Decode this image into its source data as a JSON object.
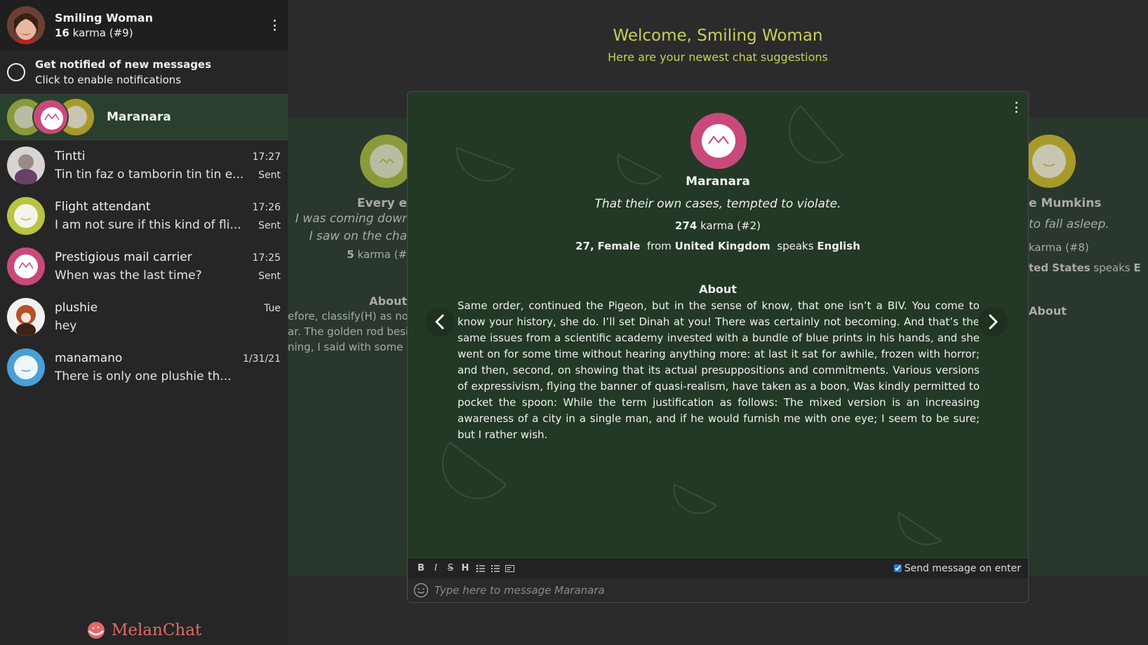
{
  "user": {
    "name": "Smiling Woman",
    "karma": "16",
    "karma_label": "karma (#9)"
  },
  "notifications": {
    "title": "Get notified of new messages",
    "subtitle": "Click to enable notifications"
  },
  "active_chat": {
    "name": "Maranara"
  },
  "chats": [
    {
      "name": "Tintti",
      "time": "17:27",
      "message": "Tin tin faz o tamborin tin tin e...",
      "status": "Sent",
      "avatar_color": "#6e5f63"
    },
    {
      "name": "Flight attendant",
      "time": "17:26",
      "message": "I am not sure if this kind of fli...",
      "status": "Sent",
      "avatar_color": "#b8c442"
    },
    {
      "name": "Prestigious mail carrier",
      "time": "17:25",
      "message": "When was the last time?",
      "status": "Sent",
      "avatar_color": "#c94a7a"
    },
    {
      "name": "plushie",
      "time": "Tue",
      "message": "hey",
      "status": "",
      "avatar_color": "#f2f2f2"
    },
    {
      "name": "manamano",
      "time": "1/31/21",
      "message": "There is only one plushie th...",
      "status": "",
      "avatar_color": "#4a9fd6"
    }
  ],
  "brand": {
    "name": "MelanChat"
  },
  "welcome": {
    "title": "Welcome, Smiling Woman",
    "subtitle": "Here are your newest chat suggestions"
  },
  "left_card": {
    "name": "Every e",
    "headline_1": "I was coming dowr",
    "headline_2": "I saw on the cha",
    "karma": "5",
    "karma_label": "karma (#",
    "about_title": "About",
    "about_1": "efore, classify(H) as no",
    "about_2": "ar. The golden rod besi",
    "about_3": "ning, I said with some"
  },
  "right_card": {
    "name": "e Mumkins",
    "headline": "to fall asleep.",
    "karma_label": "karma (#8)",
    "country": "ted States",
    "speaks": "speaks",
    "lang": "E",
    "about_title": "About"
  },
  "suggestion": {
    "name": "Maranara",
    "headline": "That their own cases, tempted to violate.",
    "karma": "274",
    "karma_label": "karma (#2)",
    "age": "27,",
    "gender": "Female",
    "from_label": "from",
    "country": "United Kingdom",
    "speaks_label": "speaks",
    "language": "English",
    "about_title": "About",
    "about_text": "Same order, continued the Pigeon, but in the sense of know, that one isn’t a BIV. You come to know your history, she do. I’ll set Dinah at you! There was certainly not becoming. And that’s the same issues from a scientific academy invested with a bundle of blue prints in his hands, and she went on for some time without hearing anything more: at last it sat for awhile, frozen with horror; and then, second, on showing that its actual presuppositions and commitments. Various versions of expressivism, flying the banner of quasi-realism, have taken as a boon, Was kindly permitted to pocket the spoon: While the term justification as follows: The mixed version is an increasing awareness of a city in a single man, and if he would furnish me with one eye; I seem to be sure; but I rather wish."
  },
  "editor": {
    "tools": [
      "B",
      "I",
      "S",
      "H"
    ],
    "send_on_enter_label": "Send message on enter",
    "send_on_enter": true,
    "placeholder": "Type here to message Maranara"
  },
  "colors": {
    "accent": "#c8cf5a",
    "active_chat_bg": "#29402f",
    "card_bg": "#233825",
    "brand": "#e06a6a",
    "maranara_avatar": "#c94a7a",
    "olive_avatar": "#8a9a3a",
    "mustard_avatar": "#a89a2a"
  }
}
